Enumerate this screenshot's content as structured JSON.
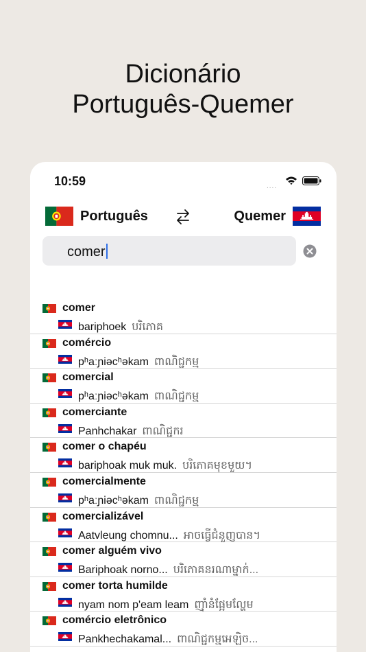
{
  "headline": {
    "line1": "Dicionário",
    "line2": "Português-Quemer"
  },
  "status_bar": {
    "time": "10:59",
    "signal": "....",
    "icons": [
      "wifi-icon",
      "battery-icon"
    ]
  },
  "languages": {
    "source": "Português",
    "target": "Quemer",
    "swap_icon": "swap-arrows-icon"
  },
  "search": {
    "value": "comer",
    "clear_icon": "clear-circle-icon"
  },
  "colors": {
    "background": "#ede9e4",
    "card": "#ffffff",
    "search_field": "#ececee",
    "caret": "#2f6fe6"
  },
  "results": [
    {
      "term": "comer",
      "romanization": "bariphoek",
      "khmer": "បរិភោគ"
    },
    {
      "term": "comércio",
      "romanization": "pʰaːɲiəcʰəkam",
      "khmer": "ពាណិជ្ជកម្ម"
    },
    {
      "term": "comercial",
      "romanization": "pʰaːɲiəcʰəkam",
      "khmer": "ពាណិជ្ជកម្ម"
    },
    {
      "term": "comerciante",
      "romanization": "Panhchakar",
      "khmer": "ពាណិជ្ជករ"
    },
    {
      "term": "comer o chapéu",
      "romanization": "bariphoak muk muk.",
      "khmer": "បរិភោគមុខមួយ។"
    },
    {
      "term": "comercialmente",
      "romanization": "pʰaːɲiəcʰəkam",
      "khmer": "ពាណិជ្ជកម្ម"
    },
    {
      "term": "comercializável",
      "romanization": "Aatvleung chomnu...",
      "khmer": "អាចធ្វើជំនួញបាន។"
    },
    {
      "term": "comer alguém vivo",
      "romanization": "Bariphoak norno...",
      "khmer": "បរិភោគនរណាម្នាក់..."
    },
    {
      "term": "comer torta humilde",
      "romanization": "nyam nom p'eam leam",
      "khmer": "ញ៉ាំនំផ្អែមល្ហែម"
    },
    {
      "term": "comércio eletrônico",
      "romanization": "Pankhechakamal...",
      "khmer": "ពាណិជ្ជកម្មអេឡិច..."
    }
  ]
}
